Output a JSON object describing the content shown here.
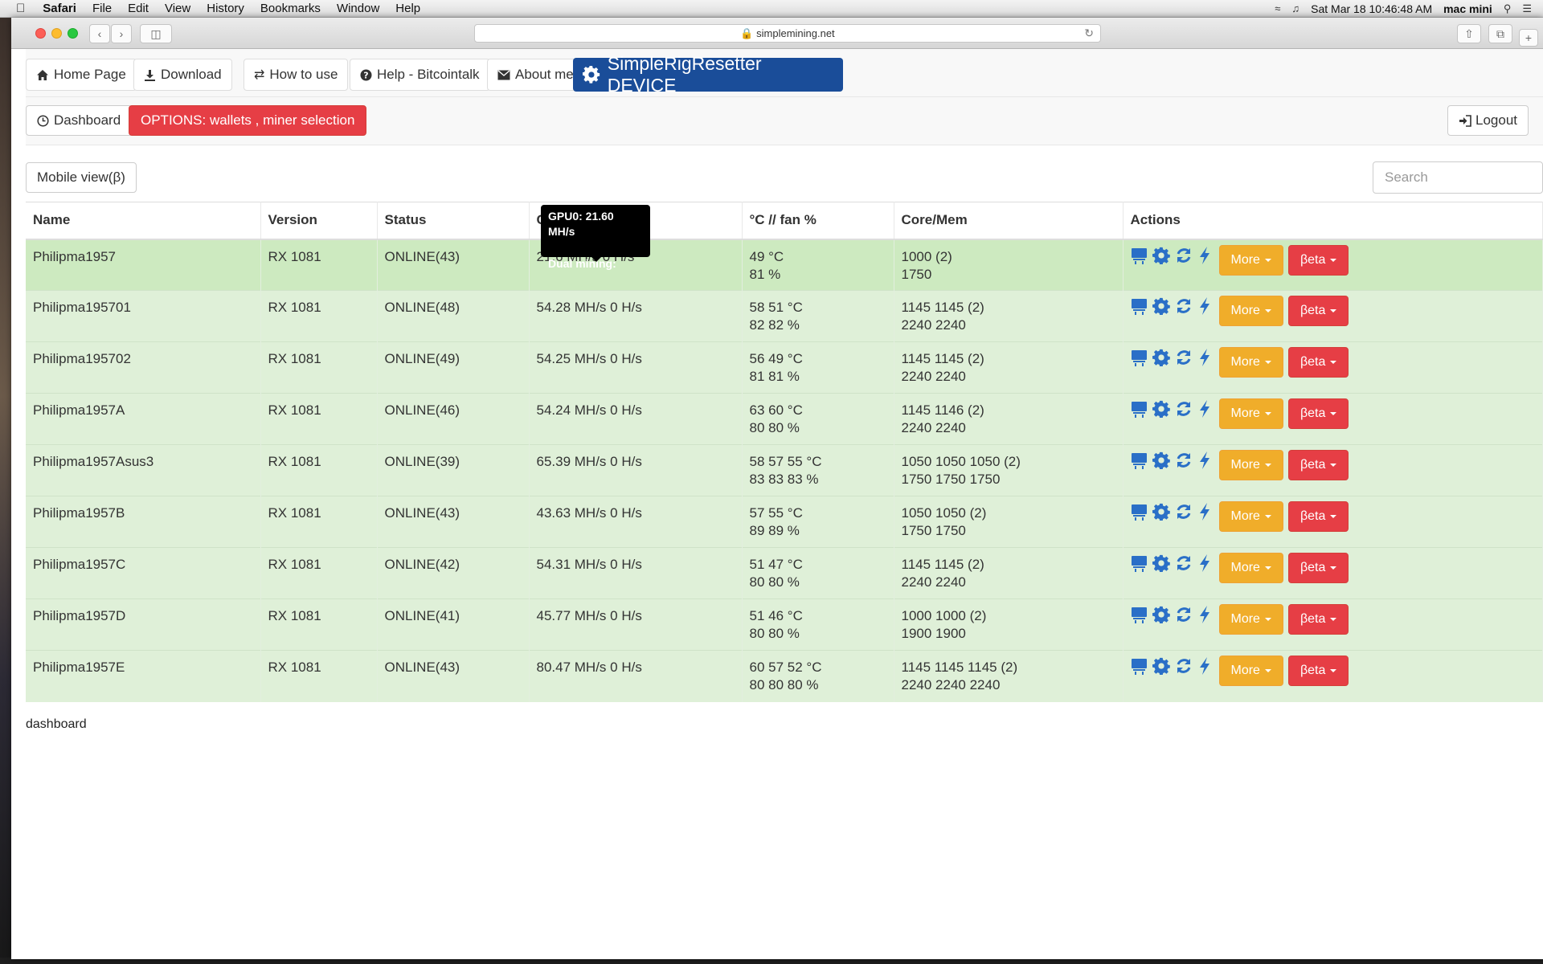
{
  "menubar": {
    "apple": "",
    "app_name": "Safari",
    "items": [
      "File",
      "Edit",
      "View",
      "History",
      "Bookmarks",
      "Window",
      "Help"
    ],
    "clock": "Sat Mar 18  10:46:48 AM",
    "user": "mac mini"
  },
  "browser": {
    "url": "simplemining.net"
  },
  "nav": {
    "home": "Home Page",
    "download": "Download",
    "how_to_use": "How to use",
    "help": "Help - Bitcointalk",
    "about": "About me",
    "brand": "SimpleRigResetter DEVICE"
  },
  "subnav": {
    "dashboard": "Dashboard",
    "options": "OPTIONS: wallets , miner selection",
    "logout": "Logout"
  },
  "mobile_view": "Mobile view(β)",
  "search": {
    "placeholder": "Search",
    "value": ""
  },
  "table": {
    "columns": {
      "name": "Name",
      "version": "Version",
      "status": "Status",
      "console": "Console",
      "temp_fan": "°C // fan %",
      "core_mem": "Core/Mem",
      "actions": "Actions"
    },
    "more_label": "More",
    "beta_label": "βeta",
    "rows": [
      {
        "name": "Philipma1957",
        "version": "RX 1081",
        "status": "ONLINE(43)",
        "speed": "21.6 MH/s 0 H/s",
        "temp": "49 °C",
        "fan": "81 %",
        "core": "1000 (2)",
        "mem": "1750"
      },
      {
        "name": "Philipma195701",
        "version": "RX 1081",
        "status": "ONLINE(48)",
        "speed": "54.28 MH/s 0 H/s",
        "temp": "58 51 °C",
        "fan": "82 82 %",
        "core": "1145 1145 (2)",
        "mem": "2240 2240"
      },
      {
        "name": "Philipma195702",
        "version": "RX 1081",
        "status": "ONLINE(49)",
        "speed": "54.25 MH/s 0 H/s",
        "temp": "56 49 °C",
        "fan": "81 81 %",
        "core": "1145 1145 (2)",
        "mem": "2240 2240"
      },
      {
        "name": "Philipma1957A",
        "version": "RX 1081",
        "status": "ONLINE(46)",
        "speed": "54.24 MH/s 0 H/s",
        "temp": "63 60 °C",
        "fan": "80 80 %",
        "core": "1145 1146 (2)",
        "mem": "2240 2240"
      },
      {
        "name": "Philipma1957Asus3",
        "version": "RX 1081",
        "status": "ONLINE(39)",
        "speed": "65.39 MH/s 0 H/s",
        "temp": "58 57 55 °C",
        "fan": "83 83 83 %",
        "core": "1050 1050 1050 (2)",
        "mem": "1750 1750 1750"
      },
      {
        "name": "Philipma1957B",
        "version": "RX 1081",
        "status": "ONLINE(43)",
        "speed": "43.63 MH/s 0 H/s",
        "temp": "57 55 °C",
        "fan": "89 89 %",
        "core": "1050 1050 (2)",
        "mem": "1750 1750"
      },
      {
        "name": "Philipma1957C",
        "version": "RX 1081",
        "status": "ONLINE(42)",
        "speed": "54.31 MH/s 0 H/s",
        "temp": "51 47 °C",
        "fan": "80 80 %",
        "core": "1145 1145 (2)",
        "mem": "2240 2240"
      },
      {
        "name": "Philipma1957D",
        "version": "RX 1081",
        "status": "ONLINE(41)",
        "speed": "45.77 MH/s 0 H/s",
        "temp": "51 46 °C",
        "fan": "80 80 %",
        "core": "1000 1000 (2)",
        "mem": "1900 1900"
      },
      {
        "name": "Philipma1957E",
        "version": "RX 1081",
        "status": "ONLINE(43)",
        "speed": "80.47 MH/s 0 H/s",
        "temp": "60 57 52 °C",
        "fan": "80 80 80 %",
        "core": "1145 1145 1145 (2)",
        "mem": "2240 2240 2240"
      }
    ]
  },
  "tooltip": {
    "line1": "GPU0: 21.60 MH/s",
    "line2": "Dual mining:"
  },
  "footer": "dashboard",
  "colors": {
    "brand": "#1a4d99",
    "danger": "#e63e45",
    "warning": "#f0ad2a",
    "row_success": "#dff0d8",
    "icon_blue": "#2a6fc7"
  }
}
